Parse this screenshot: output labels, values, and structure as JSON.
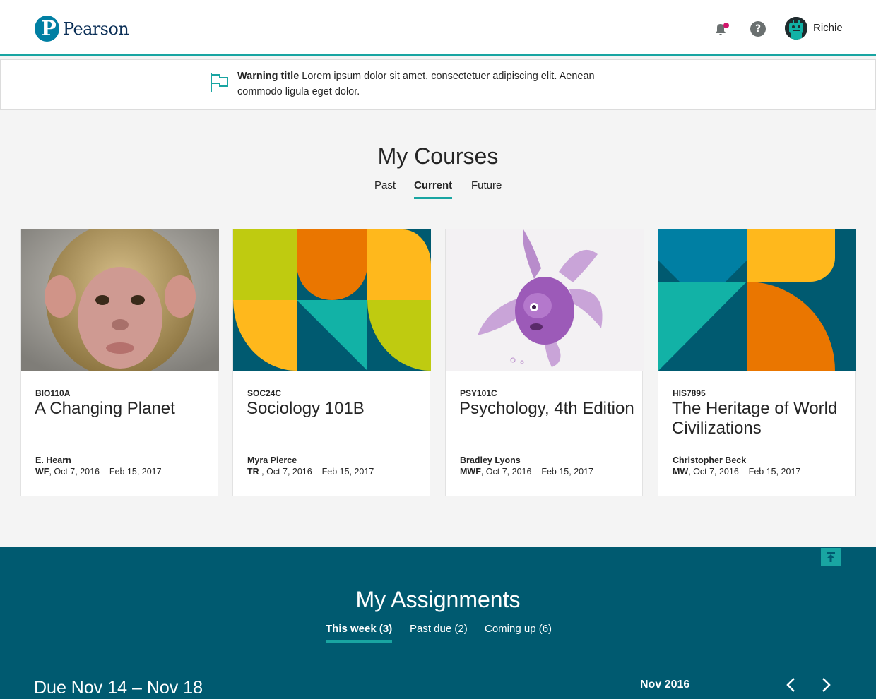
{
  "header": {
    "brand": "Pearson",
    "user_name": "Richie",
    "help_symbol": "?",
    "notification_indicator_color": "#d1156b"
  },
  "banner": {
    "title": "Warning title",
    "message": "Lorem ipsum dolor sit amet, consectetuer adipiscing elit. Aenean commodo ligula eget dolor.",
    "icon": "flag-icon"
  },
  "courses": {
    "heading": "My Courses",
    "tabs": [
      {
        "label": "Past",
        "active": false
      },
      {
        "label": "Current",
        "active": true
      },
      {
        "label": "Future",
        "active": false
      }
    ],
    "cards": [
      {
        "code": "BIO110A",
        "title": "A Changing Planet",
        "instructor": "E. Hearn",
        "days": "WF",
        "dates": ", Oct 7, 2016 – Feb 15, 2017",
        "image": "monkey-photo"
      },
      {
        "code": "SOC24C",
        "title": "Sociology 101B",
        "instructor": "Myra Pierce",
        "days": "TR",
        "dates": " , Oct 7, 2016 – Feb 15, 2017",
        "image": "geometric-pattern"
      },
      {
        "code": "PSY101C",
        "title": "Psychology, 4th Edition",
        "instructor": "Bradley Lyons",
        "days": "MWF",
        "dates": ", Oct 7, 2016 – Feb 15, 2017",
        "image": "purple-fish-illustration"
      },
      {
        "code": "HIS7895",
        "title": "The Heritage of World Civilizations",
        "instructor": "Christopher Beck",
        "days": "MW",
        "dates": ", Oct 7, 2016 – Feb 15, 2017",
        "image": "geometric-pattern"
      }
    ]
  },
  "assignments": {
    "heading": "My Assignments",
    "tabs": [
      {
        "label": "This week (3)",
        "active": true
      },
      {
        "label": "Past due (2)",
        "active": false
      },
      {
        "label": "Coming up (6)",
        "active": false
      }
    ],
    "due_range": "Due Nov 14 – Nov 18",
    "month": "Nov 2016"
  },
  "colors": {
    "accent_teal": "#19a5a2",
    "brand_blue": "#007fa3",
    "assignments_bg": "#005a70",
    "pattern_lime": "#bfcb10",
    "pattern_orange": "#ea7600",
    "pattern_gold": "#ffb81c",
    "pattern_navy": "#005a70",
    "pattern_teal": "#12b2a6"
  }
}
